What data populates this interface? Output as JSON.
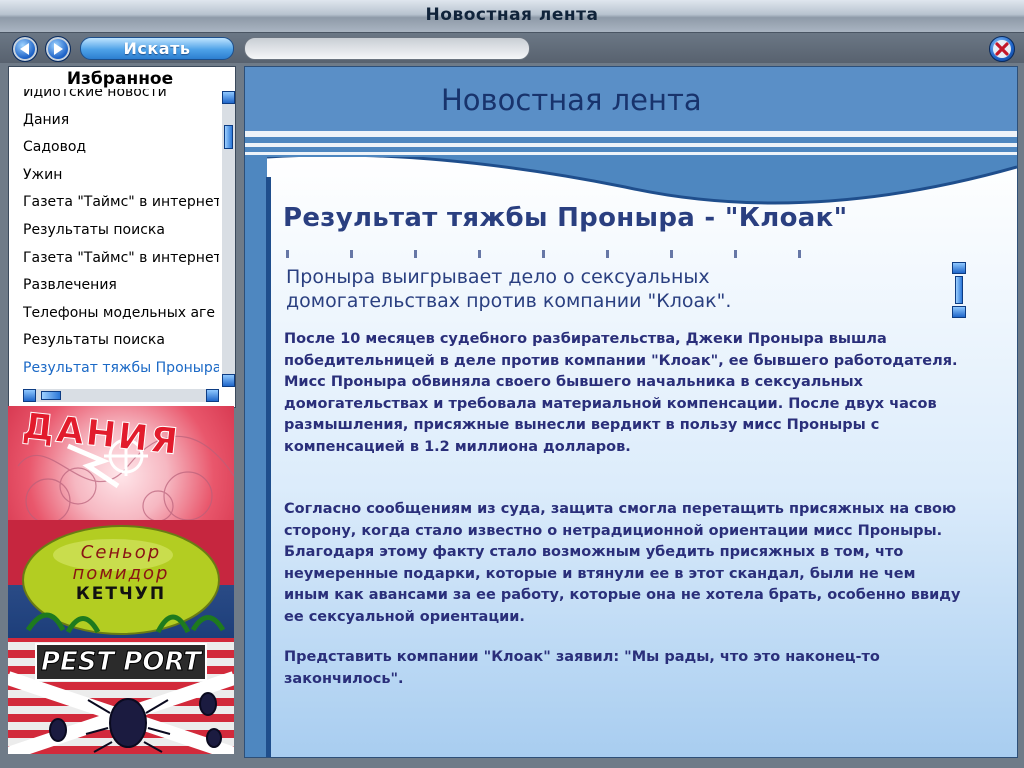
{
  "window": {
    "title": "Новостная лента"
  },
  "toolbar": {
    "search_label": "Искать",
    "search_value": ""
  },
  "favorites": {
    "title": "Избранное",
    "items": [
      "Идиотские новости",
      "Дания",
      "Садовод",
      "Ужин",
      "Газета \"Таймс\" в интернет",
      "Результаты поиска",
      "Газета \"Таймс\" в интернет",
      "Развлечения",
      "Телефоны модельных аге",
      "Результаты поиска",
      "Результат тяжбы Проныра"
    ],
    "active_index": 10
  },
  "ads": {
    "ad1": {
      "text": "ДАНИЯ"
    },
    "ad2": {
      "line1": "Сеньор",
      "line2": "помидор",
      "line3": "КЕТЧУП"
    },
    "ad3": {
      "text": "PEST PORT"
    }
  },
  "main": {
    "header_title": "Новостная лента",
    "article": {
      "title": "Результат тяжбы Проныра - \"Клоак\"",
      "subtitle": "Проныра выигрывает дело о сексуальных домогательствах против компании \"Клоак\".",
      "p1": "После 10 месяцев судебного разбирательства, Джеки Проныра вышла победительницей в деле против компании \"Клоак\", ее бывшего работодателя. Мисс Проныра обвиняла своего бывшего начальника в сексуальных домогательствах и требовала материальной компенсации. После двух часов размышления, присяжные вынесли вердикт в пользу мисс Проныры с компенсацией в 1.2 миллиона долларов.",
      "p2": "Согласно сообщениям из суда, защита смогла перетащить присяжных на свою сторону, когда стало известно о нетрадиционной ориентации мисс Проныры. Благодаря этому факту стало возможным убедить присяжных в том, что неумеренные подарки, которые и втянули ее в этот скандал, были не чем иным как авансами за ее работу, которые она не хотела брать, особенно ввиду ее сексуальной ориентации.",
      "p3": "Представить компании \"Клоак\" заявил: \"Мы рады, что это наконец-то закончилось\"."
    }
  },
  "colors": {
    "accent": "#1b69c6",
    "content_bg": "#4e87c0",
    "text_dark": "#2a3f80"
  }
}
